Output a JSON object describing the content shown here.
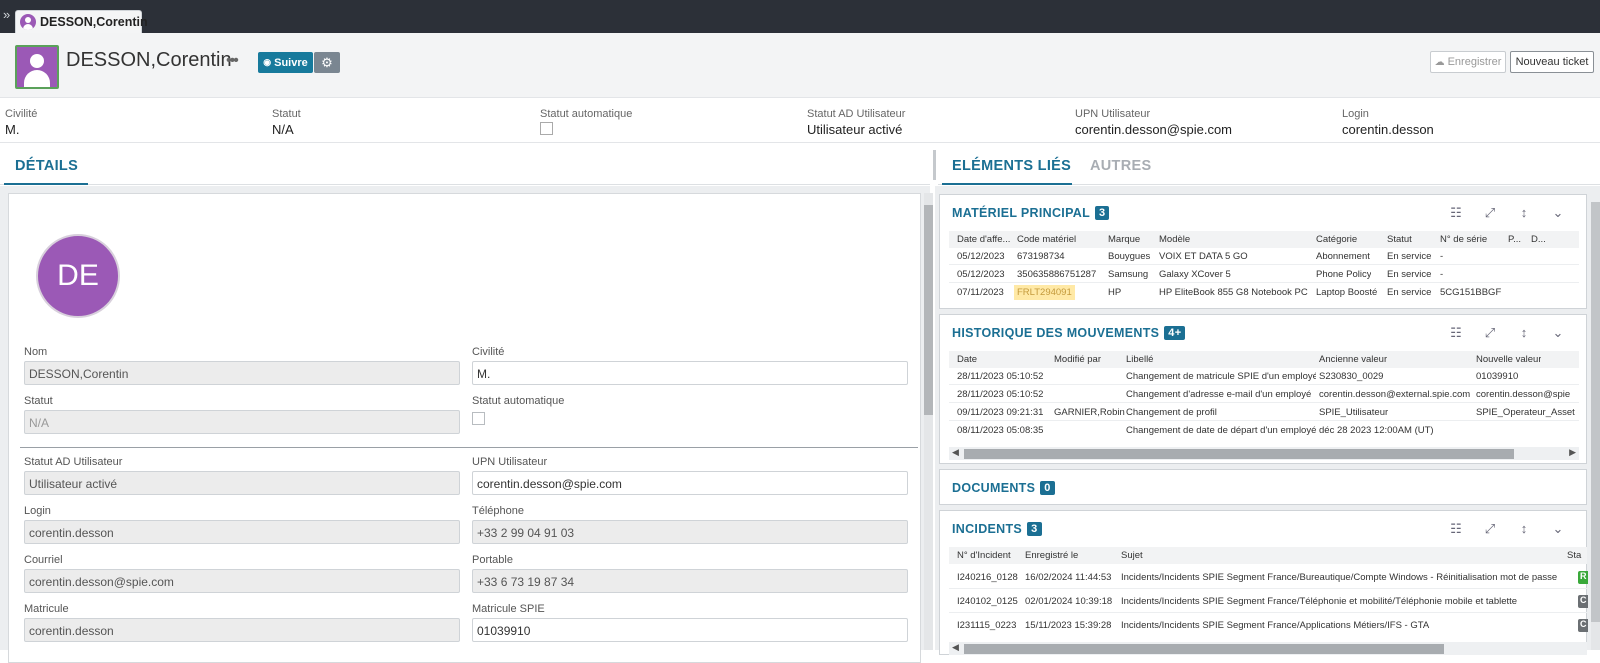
{
  "tab": {
    "label": "DESSON,Corentin"
  },
  "header": {
    "title": "DESSON,Corentin",
    "follow_label": "Suivre",
    "save_label": "Enregistrer",
    "new_ticket_label": "Nouveau ticket"
  },
  "summary": [
    {
      "label": "Civilité",
      "value": "M."
    },
    {
      "label": "Statut",
      "value": "N/A"
    },
    {
      "label": "Statut automatique",
      "value": ""
    },
    {
      "label": "Statut AD Utilisateur",
      "value": "Utilisateur activé"
    },
    {
      "label": "UPN Utilisateur",
      "value": "corentin.desson@spie.com"
    },
    {
      "label": "Login",
      "value": "corentin.desson"
    }
  ],
  "left_tab": "DÉTAILS",
  "right_tabs": [
    "ELÉMENTS LIÉS",
    "AUTRES"
  ],
  "details": {
    "initials": "DE",
    "nom": {
      "label": "Nom",
      "value": "DESSON,Corentin"
    },
    "civilite": {
      "label": "Civilité",
      "value": "M."
    },
    "statut": {
      "label": "Statut",
      "value": "N/A"
    },
    "statut_auto": {
      "label": "Statut automatique"
    },
    "statut_ad": {
      "label": "Statut AD Utilisateur",
      "value": "Utilisateur activé"
    },
    "upn": {
      "label": "UPN Utilisateur",
      "value": "corentin.desson@spie.com"
    },
    "login": {
      "label": "Login",
      "value": "corentin.desson"
    },
    "telephone": {
      "label": "Téléphone",
      "value": "+33 2 99 04 91 03"
    },
    "courriel": {
      "label": "Courriel",
      "value": "corentin.desson@spie.com"
    },
    "portable": {
      "label": "Portable",
      "value": "+33 6 73 19 87 34"
    },
    "matricule": {
      "label": "Matricule",
      "value": "corentin.desson"
    },
    "matricule_spie": {
      "label": "Matricule SPIE",
      "value": "01039910"
    }
  },
  "materiel": {
    "title": "MATÉRIEL PRINCIPAL",
    "count": "3",
    "columns": [
      "Date d'affe...",
      "Code matériel",
      "Marque",
      "Modèle",
      "Catégorie",
      "Statut",
      "N° de série",
      "P...",
      "D..."
    ],
    "rows": [
      [
        "05/12/2023",
        "673198734",
        "Bouygues",
        "VOIX ET DATA 5 GO",
        "Abonnement",
        "En service",
        "-",
        "",
        ""
      ],
      [
        "05/12/2023",
        "350635886751287",
        "Samsung",
        "Galaxy XCover 5",
        "Phone Policy",
        "En service",
        "-",
        "",
        ""
      ],
      [
        "07/11/2023",
        "FRLT294091",
        "HP",
        "HP EliteBook 855 G8 Notebook PC",
        "Laptop Boosté",
        "En service",
        "5CG151BBGF",
        "",
        ""
      ]
    ]
  },
  "historique": {
    "title": "HISTORIQUE DES MOUVEMENTS",
    "count": "4+",
    "columns": [
      "Date",
      "Modifié par",
      "Libellé",
      "Ancienne valeur",
      "Nouvelle valeur"
    ],
    "rows": [
      [
        "28/11/2023 05:10:52",
        "",
        "Changement de matricule SPIE d'un employé",
        "S230830_0029",
        "01039910"
      ],
      [
        "28/11/2023 05:10:52",
        "",
        "Changement d'adresse e-mail d'un employé",
        "corentin.desson@external.spie.com",
        "corentin.desson@spie"
      ],
      [
        "09/11/2023 09:21:31",
        "GARNIER,Robin",
        "Changement de profil",
        "SPIE_Utilisateur",
        "SPIE_Operateur_Asset"
      ],
      [
        "08/11/2023 05:08:35",
        "",
        "Changement de date de départ d'un employé",
        "déc 28 2023 12:00AM (UT)",
        ""
      ]
    ]
  },
  "documents": {
    "title": "DOCUMENTS",
    "count": "0"
  },
  "incidents": {
    "title": "INCIDENTS",
    "count": "3",
    "columns": [
      "N° d'Incident",
      "Enregistré le",
      "Sujet",
      "Sta"
    ],
    "rows": [
      {
        "id": "I240216_0128",
        "date": "16/02/2024 11:44:53",
        "sujet": "Incidents/Incidents SPIE Segment France/Bureautique/Compte Windows - Réinitialisation mot de passe",
        "status": "R",
        "color": "#3aa93a"
      },
      {
        "id": "I240102_0125",
        "date": "02/01/2024 10:39:18",
        "sujet": "Incidents/Incidents SPIE Segment France/Téléphonie et mobilité/Téléphonie mobile et tablette",
        "status": "C",
        "color": "#6b6f73"
      },
      {
        "id": "I231115_0223",
        "date": "15/11/2023 15:39:28",
        "sujet": "Incidents/Incidents SPIE Segment France/Applications Métiers/IFS - GTA",
        "status": "C",
        "color": "#6b6f73"
      }
    ]
  },
  "colors": {
    "accent": "#1b6f93",
    "avatar": "#9b59b6",
    "topbar": "#2c3038",
    "highlight": "#ffe9a6"
  }
}
